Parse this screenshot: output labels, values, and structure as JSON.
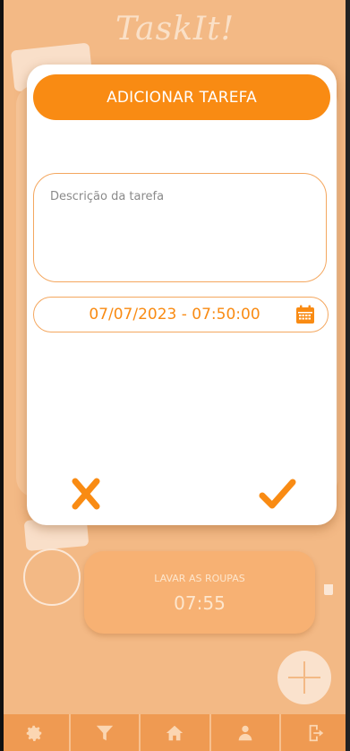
{
  "app": {
    "title": "TaskIt!"
  },
  "background_task": {
    "title": "LAVAR AS ROUPAS",
    "time": "07:55"
  },
  "modal": {
    "header": "ADICIONAR TAREFA",
    "description_placeholder": "Descrição da tarefa",
    "description_value": "",
    "datetime": "07/07/2023 - 07:50:00"
  },
  "nav": [
    {
      "icon": "gear-icon"
    },
    {
      "icon": "filter-icon"
    },
    {
      "icon": "home-icon"
    },
    {
      "icon": "user-icon"
    },
    {
      "icon": "logout-icon"
    }
  ],
  "colors": {
    "accent": "#f98b13",
    "background": "#f3b985",
    "nav": "#ef9a52"
  }
}
